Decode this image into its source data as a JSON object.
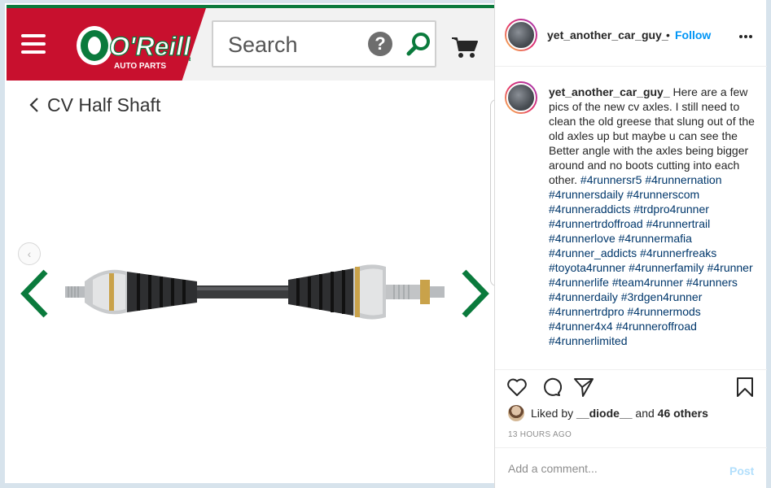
{
  "store": {
    "logo_text": "O'Reilly",
    "logo_sub": "AUTO PARTS",
    "search_placeholder": "Search",
    "help_glyph": "?",
    "page_title": "CV Half Shaft",
    "brand_red": "#c8102e",
    "brand_green": "#0a7a3c"
  },
  "post": {
    "username": "yet_another_car_guy_",
    "separator": "•",
    "follow_label": "Follow",
    "caption_text": "Here are a few pics of the new cv axles. I still need to clean the old greese that slung out of the old axles up but maybe u can see the Better angle with the axles being bigger around and no boots cutting into each other.",
    "hashtags": [
      "#4runnersr5",
      "#4runnernation",
      "#4runnersdaily",
      "#4runnerscom",
      "#4runneraddicts",
      "#trdpro4runner",
      "#4runnertrdoffroad",
      "#4runnertrail",
      "#4runnerlove",
      "#4runnermafia",
      "#4runner_addicts",
      "#4runnerfreaks",
      "#toyota4runner",
      "#4runnerfamily",
      "#4runner",
      "#4runnerlife",
      "#team4runner",
      "#4runners",
      "#4runnerdaily",
      "#3rdgen4runner",
      "#4runnertrdpro",
      "#4runnermods",
      "#4runner4x4",
      "#4runneroffroad",
      "#4runnerlimited"
    ],
    "liked_by_prefix": "Liked by",
    "liked_by_user": "__diode__",
    "liked_by_and": "and",
    "liked_by_others": "46 others",
    "timestamp": "13 HOURS AGO",
    "comment_placeholder": "Add a comment...",
    "post_label": "Post",
    "accent": "#0095f6"
  },
  "icons": [
    "menu-icon",
    "help-icon",
    "search-icon",
    "cart-icon",
    "back-chevron-icon",
    "prev-arrow-icon",
    "next-arrow-icon",
    "more-icon",
    "heart-icon",
    "comment-icon",
    "share-icon",
    "bookmark-icon"
  ]
}
